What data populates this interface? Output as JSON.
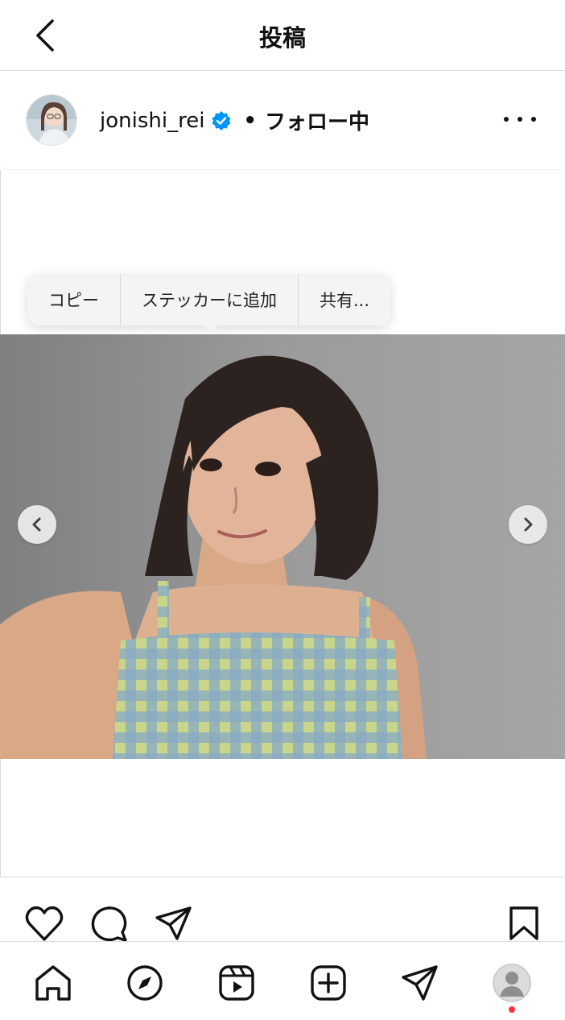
{
  "header": {
    "title": "投稿"
  },
  "post": {
    "username": "jonishi_rei",
    "separator": "•",
    "follow_status": "フォロー中"
  },
  "context_menu": {
    "items": [
      "コピー",
      "ステッカーに追加",
      "共有..."
    ]
  },
  "colors": {
    "verified": "#0095f6",
    "notification_dot": "#ff3040",
    "photo_bg": "#8e8e8e"
  },
  "icons": {
    "header": [
      "back-icon",
      "more-options-icon"
    ],
    "actions": [
      "like-icon",
      "comment-icon",
      "share-icon",
      "save-icon"
    ],
    "bottom_nav": [
      "home-icon",
      "explore-icon",
      "reels-icon",
      "create-icon",
      "direct-icon",
      "profile-icon"
    ]
  }
}
